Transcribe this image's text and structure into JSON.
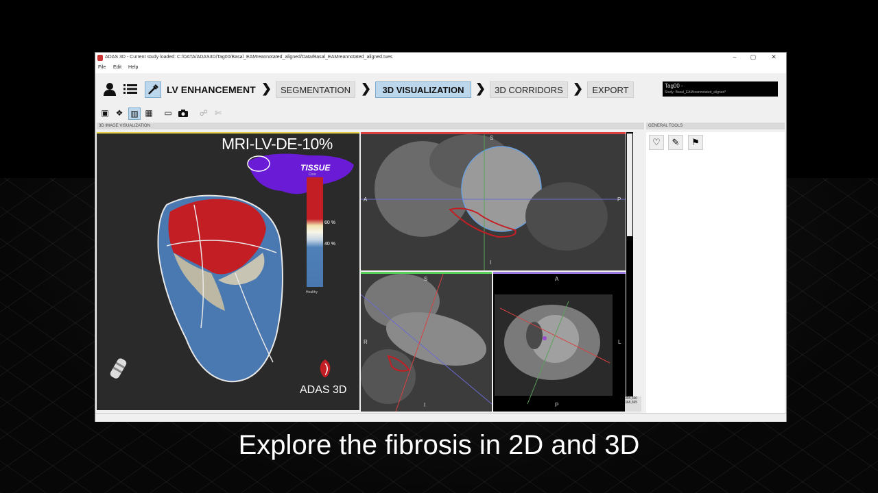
{
  "window": {
    "title": "ADAS 3D - Current study loaded: C:/DATA/ADAS3D/Tag00/Basal_EAMreannotated_aligned/Data/Basal_EAMreannotated_aligned.tues",
    "controls": {
      "minimize": "–",
      "maximize": "▢",
      "close": "✕"
    }
  },
  "menu": {
    "file": "File",
    "edit": "Edit",
    "help": "Help"
  },
  "workflow": {
    "current_module": "LV ENHANCEMENT",
    "steps": [
      "SEGMENTATION",
      "3D VISUALIZATION",
      "3D CORRIDORS",
      "EXPORT"
    ],
    "active_step": "3D VISUALIZATION",
    "chevron": "❯"
  },
  "study": {
    "name": "Tag00 -",
    "detail": "Study: Basal_EAMreannotated_aligned*"
  },
  "panels": {
    "view3d_header": "3D IMAGE VISUALIZATION",
    "tools_header": "GENERAL TOOLS"
  },
  "view3d": {
    "sequence_label": "MRI-LV-DE-10%",
    "legend": {
      "title": "TISSUE",
      "subtitle": "Core",
      "pct_upper": "60 %",
      "pct_lower": "40 %",
      "bottom": "Healthy"
    },
    "brand": "ADAS 3D"
  },
  "axial": {
    "left": "A",
    "right": "P",
    "top": "S",
    "bottom": "I"
  },
  "sagittal": {
    "top": "S",
    "bottom": "I",
    "left": "R"
  },
  "coronal": {
    "top": "A",
    "bottom": "P",
    "right": "L"
  },
  "coords": {
    "line1": "304,360",
    "line2": "368,365"
  },
  "icons": {
    "user": "user-icon",
    "list": "list-icon",
    "enhance": "syringe-icon",
    "camera": "camera-icon",
    "monitor": "monitor-icon"
  },
  "caption": "Explore the fibrosis in 2D and 3D",
  "colors": {
    "active_step_bg": "#bcd7ec",
    "scar": "#c41e25",
    "healthy": "#4a78b0"
  }
}
